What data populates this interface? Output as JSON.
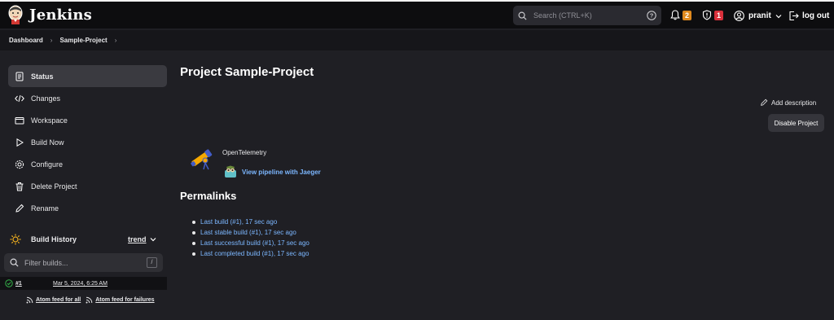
{
  "app": {
    "name": "Jenkins"
  },
  "search": {
    "placeholder": "Search (CTRL+K)"
  },
  "header": {
    "notifications_count": "2",
    "security_count": "1",
    "user_name": "pranit",
    "logout_label": "log out"
  },
  "breadcrumb": {
    "items": [
      "Dashboard",
      "Sample-Project"
    ]
  },
  "sidebar": {
    "items": [
      {
        "label": "Status",
        "icon": "status-icon"
      },
      {
        "label": "Changes",
        "icon": "code-icon"
      },
      {
        "label": "Workspace",
        "icon": "folder-icon"
      },
      {
        "label": "Build Now",
        "icon": "play-icon"
      },
      {
        "label": "Configure",
        "icon": "gear-icon"
      },
      {
        "label": "Delete Project",
        "icon": "trash-icon"
      },
      {
        "label": "Rename",
        "icon": "pencil-icon"
      }
    ]
  },
  "build_history": {
    "title": "Build History",
    "trend_label": "trend",
    "filter_placeholder": "Filter builds...",
    "filter_shortcut": "/",
    "builds": [
      {
        "number": "#1",
        "date": "Mar 5, 2024, 6:25 AM",
        "status": "success"
      }
    ],
    "feed_all": "Atom feed for all",
    "feed_failures": "Atom feed for failures"
  },
  "main": {
    "title": "Project Sample-Project",
    "add_description": "Add description",
    "disable_project": "Disable Project",
    "otel_label": "OpenTelemetry",
    "jaeger_link": "View pipeline with Jaeger",
    "permalinks_title": "Permalinks",
    "permalinks": [
      "Last build (#1), 17 sec ago",
      "Last stable build (#1), 17 sec ago",
      "Last successful build (#1), 17 sec ago",
      "Last completed build (#1), 17 sec ago"
    ]
  },
  "colors": {
    "background": "#1f1f24",
    "topbar": "#0d0d0f",
    "link": "#7cb7ff",
    "notification_badge": "#e08a1e",
    "security_badge": "#d9303b",
    "success": "#35b24a"
  }
}
